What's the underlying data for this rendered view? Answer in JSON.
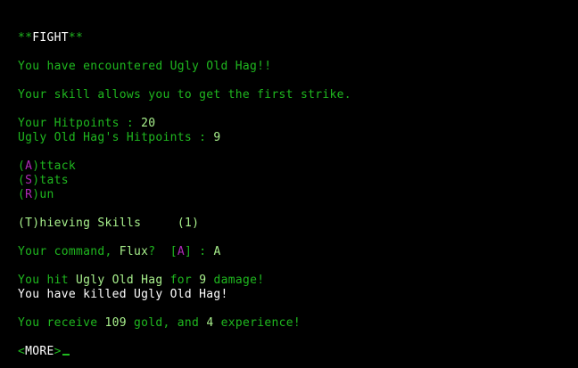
{
  "fight": {
    "left": "**",
    "title": "FIGHT",
    "right": "**"
  },
  "encounter": "You have encountered Ugly Old Hag!!",
  "first_strike": "Your skill allows you to get the first strike.",
  "hitpoints": {
    "player_label": "Your Hitpoints : ",
    "player_value": "20",
    "enemy_label": "Ugly Old Hag's Hitpoints : ",
    "enemy_value": "9"
  },
  "menu": {
    "attack": {
      "open": "(",
      "key": "A",
      "close": ")",
      "rest": "ttack"
    },
    "stats": {
      "open": "(",
      "key": "S",
      "close": ")",
      "rest": "tats"
    },
    "run": {
      "open": "(",
      "key": "R",
      "close": ")",
      "rest": "un"
    },
    "thieving": {
      "open": "(",
      "key": "T",
      "close": ")",
      "rest": "hieving Skills     ",
      "count": "(1)"
    }
  },
  "command": {
    "prefix": "Your command, ",
    "player": "Flux",
    "q": "?  ",
    "bracket_open": "[",
    "default_key": "A",
    "bracket_close": "]",
    "sep": " : ",
    "input": "A"
  },
  "hit": {
    "pre": "You hit ",
    "target": "Ugly Old Hag",
    "mid": " for ",
    "damage": "9",
    "post": " damage!"
  },
  "killed": "You have killed Ugly Old Hag!",
  "reward": {
    "pre": "You receive ",
    "gold": "109",
    "mid": " gold, and ",
    "exp": "4",
    "post": " experience!"
  },
  "more": {
    "open": "<",
    "label": "MORE",
    "close": ">"
  },
  "colors": {
    "background": "#000000",
    "text": "#1fb81f",
    "highlight": "#a8f08c",
    "white": "#ffffff",
    "hotkey": "#b02ab8"
  }
}
